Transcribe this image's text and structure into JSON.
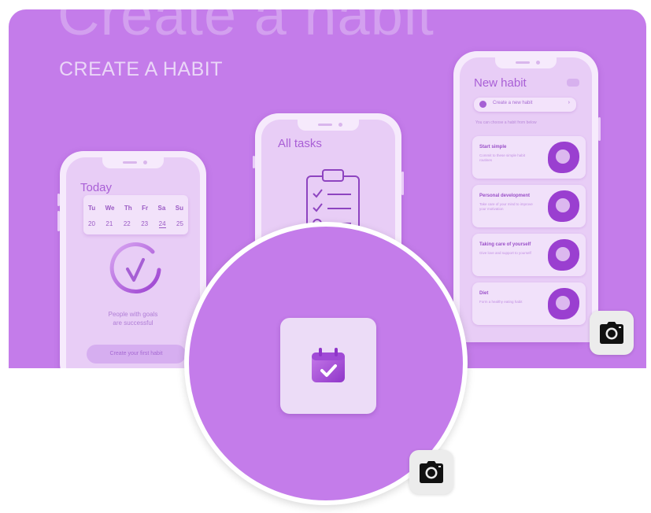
{
  "banner": {
    "ghost_title": "Create a habit",
    "subtitle": "CREATE A HABIT"
  },
  "phone_today": {
    "title": "Today",
    "weekdays": [
      "Tu",
      "We",
      "Th",
      "Fr",
      "Sa",
      "Su"
    ],
    "dates": [
      "20",
      "21",
      "22",
      "23",
      "24",
      "25"
    ],
    "selected_date": "24",
    "message_line1": "People with goals",
    "message_line2": "are successful",
    "button_label": "Create your first habit"
  },
  "phone_tasks": {
    "title": "All tasks"
  },
  "phone_new": {
    "title": "New habit",
    "create_label": "Create a new habit",
    "hint": "You can choose a habit from below",
    "cards": [
      {
        "title": "Start simple",
        "desc": "Commit to these simple habit routines"
      },
      {
        "title": "Personal development",
        "desc": "Take care of your mind to improve your motivation"
      },
      {
        "title": "Taking care of yourself",
        "desc": "Give love and support to yourself"
      },
      {
        "title": "Diet",
        "desc": "Form a healthy eating habit"
      }
    ]
  },
  "icons": {
    "camera": "camera-icon",
    "calendar": "calendar-check-icon"
  },
  "colors": {
    "banner": "#c47cea",
    "accent": "#a65fd4",
    "phone_screen": "#e8cdf6"
  }
}
